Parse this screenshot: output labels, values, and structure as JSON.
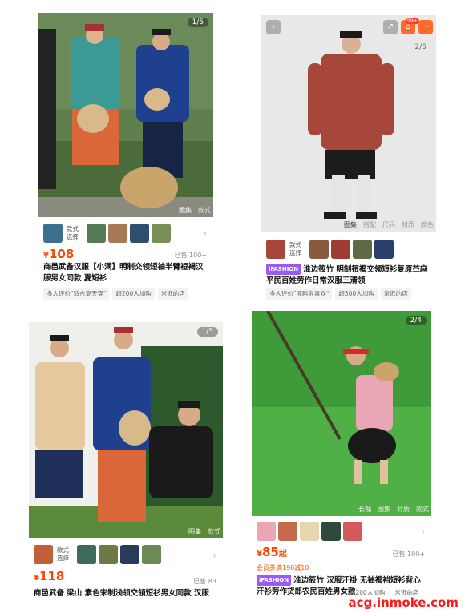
{
  "cards": [
    {
      "counter": "1/5",
      "gallery": [
        "图集",
        "款式"
      ],
      "swatch_label": "款式选择",
      "price": "108",
      "sold": "已售 100+",
      "title": "商邑武备汉服【小满】明制交领短袖半臂裋褐汉服男女同款 夏短衫",
      "tags": [
        "多人评价\"适合夏天穿\"",
        "超200人加购",
        "常逛的店"
      ]
    },
    {
      "counter": "2/5",
      "gallery": [
        "图集",
        "搭配",
        "尺码",
        "材质",
        "颜色"
      ],
      "swatch_label": "款式选择",
      "price": "",
      "sold": "",
      "badge": "iFASHION",
      "title": "淮边筱竹 明制裋褐交领短衫复原苎麻平民百姓劳作日常汉服三清领",
      "tags": [
        "多人评价\"面料很喜欢\"",
        "超500人加购",
        "常逛的店"
      ],
      "cart_count": "99+"
    },
    {
      "counter": "1/5",
      "gallery": [
        "图集",
        "款式"
      ],
      "swatch_label": "款式选择",
      "price": "118",
      "sold": "已售 83",
      "title": "商邑武备 梁山 素色宋制浅领交领短衫男女同款 汉服"
    },
    {
      "counter": "2/4",
      "gallery": [
        "长视",
        "图集",
        "材质",
        "款式"
      ],
      "price": "85",
      "price_suffix": "起",
      "sold": "已售 100+",
      "coupon": "会员券满198减10",
      "badge": "iFASHION",
      "title": "淮边筱竹 汉服汗褂 无袖褐裆短衫背心汗衫劳作货郎农民百姓男女款",
      "tags": [
        "超200人加购",
        "常逛的店"
      ]
    }
  ],
  "watermark": "acg.inmoke.com",
  "colors": {
    "price": "#ff4400",
    "badge": "#9b59f6",
    "watermark": "#ff1a1a"
  },
  "icons": [
    "back-arrow-icon",
    "share-icon",
    "cart-icon",
    "chevron-right-icon"
  ]
}
